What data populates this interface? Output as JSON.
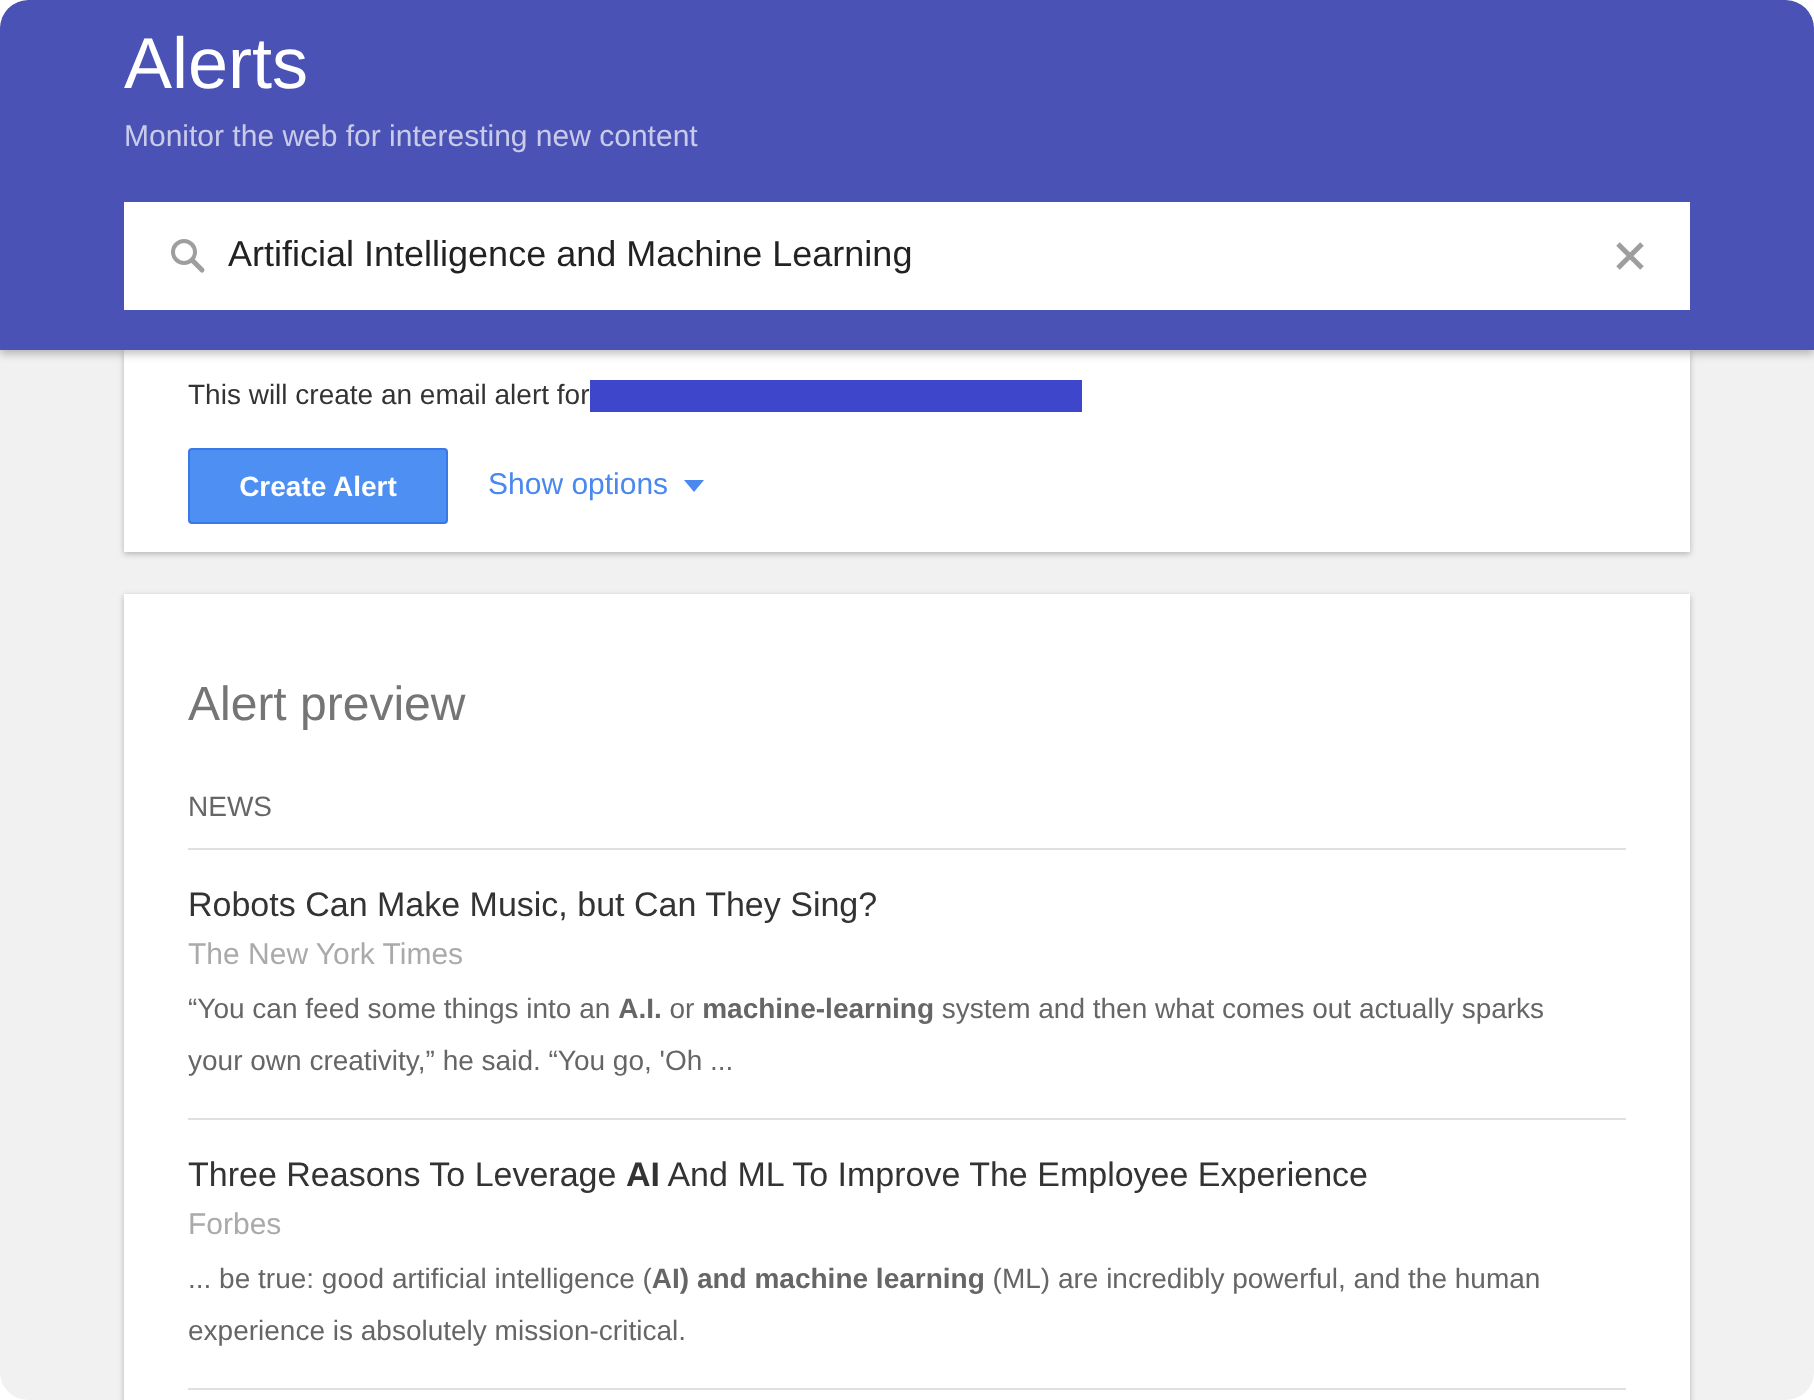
{
  "header": {
    "title": "Alerts",
    "subtitle": "Monitor the web for interesting new content"
  },
  "search": {
    "value": "Artificial Intelligence and Machine Learning"
  },
  "create_card": {
    "notice": "This will create an email alert for",
    "create_button": "Create Alert",
    "options_link": "Show options"
  },
  "preview": {
    "title": "Alert preview",
    "section": "NEWS",
    "articles": [
      {
        "headline": "Robots Can Make Music, but Can They Sing?",
        "source": "The New York Times",
        "snippet": "“You can feed some things into an **A.I.** or **machine-learning** system and then what comes out actually sparks your own creativity,” he said. “You go, 'Oh ..."
      },
      {
        "headline": "Three Reasons To Leverage **AI** And ML To Improve The Employee Experience",
        "source": "Forbes",
        "snippet": "... be true: good artificial intelligence (**AI) and machine learning** (ML) are incredibly powerful, and the human experience is absolutely mission-critical."
      }
    ]
  }
}
